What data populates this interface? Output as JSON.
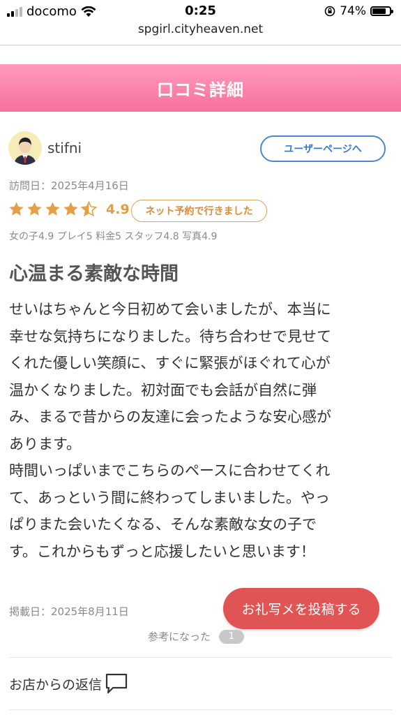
{
  "status_bar": {
    "carrier": "docomo",
    "time": "0:25",
    "battery": "74%",
    "battery_level": 0.74
  },
  "browser": {
    "url": "spgirl.cityheaven.net"
  },
  "header": {
    "title": "口コミ詳細"
  },
  "review": {
    "username": "stifni",
    "user_page_label": "ユーザーページへ",
    "visit_date": "訪問日：2025年4月16日",
    "rating": "4.9",
    "rating_value": 4.5,
    "booking_badge": "ネット予約で行きました",
    "sub_ratings": "女の子4.9 プレイ5 料金5 スタッフ4.8 写真4.9",
    "title": "心温まる素敵な時間",
    "lines": [
      "せいはちゃんと今日初めて会いましたが、本当に",
      "幸せな気持ちになりました。待ち合わせで見せて",
      "くれた優しい笑顔に、すぐに緊張がほぐれて心が",
      "温かくなりました。初対面でも会話が自然に弾",
      "み、まるで昔からの友達に会ったような安心感が",
      "あります。",
      "時間いっぱいまでこちらのペースに合わせてくれ",
      "て、あっという間に終わってしまいました。やっ",
      "ぱりまた会いたくなる、そんな素敵な女の子で",
      "す。これからもずっと応援したいと思います！"
    ],
    "posted_date": "掲載日：2025年8月11日",
    "helpful_label": "参考になった",
    "helpful_count": "1",
    "reply_label": "お店からの返信"
  },
  "cta": {
    "label": "お礼写メを投稿する"
  },
  "colors": {
    "banner_top": "#ff9bbd",
    "banner_bottom": "#f7709b",
    "star": "#e3a048",
    "cta": "#e05454",
    "link_blue": "#3a78cc"
  }
}
